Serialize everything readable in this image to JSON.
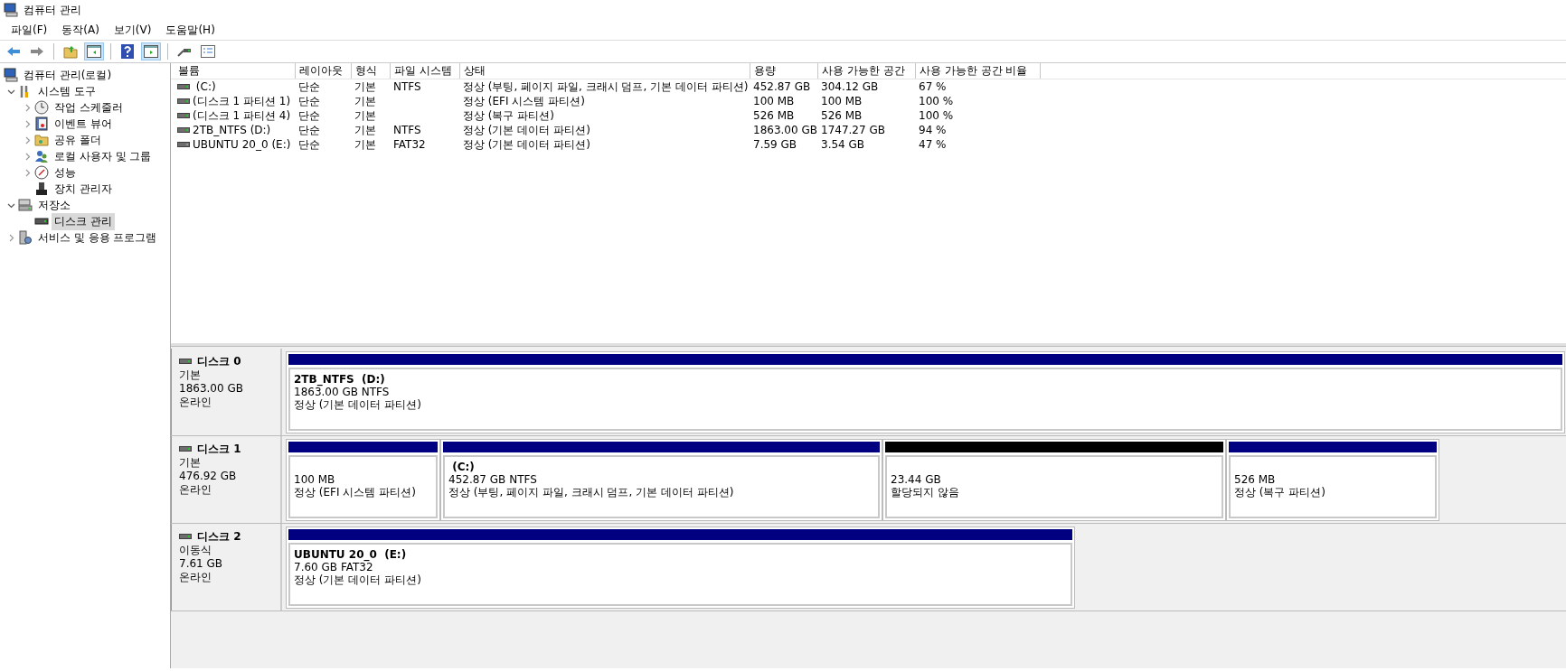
{
  "window": {
    "title": "컴퓨터 관리"
  },
  "menu": [
    "파일(F)",
    "동작(A)",
    "보기(V)",
    "도움말(H)"
  ],
  "toolbar": {
    "console_tree_pressed": true,
    "action_pane_pressed": true
  },
  "tree": [
    {
      "label": "컴퓨터 관리(로컬)",
      "selected": false,
      "children": [
        {
          "label": "시스템 도구",
          "expanded": true,
          "selected": false,
          "children": [
            {
              "label": "작업 스케줄러",
              "expanded": false,
              "selected": false
            },
            {
              "label": "이벤트 뷰어",
              "expanded": false,
              "selected": false
            },
            {
              "label": "공유 폴더",
              "expanded": false,
              "selected": false
            },
            {
              "label": "로컬 사용자 및 그룹",
              "expanded": false,
              "selected": false
            },
            {
              "label": "성능",
              "expanded": false,
              "selected": false
            },
            {
              "label": "장치 관리자",
              "selected": false
            }
          ]
        },
        {
          "label": "저장소",
          "expanded": true,
          "selected": false,
          "children": [
            {
              "label": "디스크 관리",
              "selected": true
            }
          ]
        },
        {
          "label": "서비스 및 응용 프로그램",
          "expanded": false,
          "selected": false
        }
      ]
    }
  ],
  "volumes": {
    "columns": [
      "볼륨",
      "레이아웃",
      "형식",
      "파일 시스템",
      "상태",
      "용량",
      "사용 가능한 공간",
      "사용 가능한 공간 비율"
    ],
    "rows": [
      {
        "kind": "fixed",
        "cells": [
          " (C:)",
          "단순",
          "기본",
          "NTFS",
          "정상 (부팅, 페이지 파일, 크래시 덤프, 기본 데이터 파티션)",
          "452.87 GB",
          "304.12 GB",
          "67 %"
        ]
      },
      {
        "kind": "fixed",
        "cells": [
          "(디스크 1 파티션 1)",
          "단순",
          "기본",
          "",
          "정상 (EFI 시스템 파티션)",
          "100 MB",
          "100 MB",
          "100 %"
        ]
      },
      {
        "kind": "fixed",
        "cells": [
          "(디스크 1 파티션 4)",
          "단순",
          "기본",
          "",
          "정상 (복구 파티션)",
          "526 MB",
          "526 MB",
          "100 %"
        ]
      },
      {
        "kind": "fixed",
        "cells": [
          "2TB_NTFS (D:)",
          "단순",
          "기본",
          "NTFS",
          "정상 (기본 데이터 파티션)",
          "1863.00 GB",
          "1747.27 GB",
          "94 %"
        ]
      },
      {
        "kind": "removable",
        "cells": [
          "UBUNTU 20_0 (E:)",
          "단순",
          "기본",
          "FAT32",
          "정상 (기본 데이터 파티션)",
          "7.59 GB",
          "3.54 GB",
          "47 %"
        ]
      }
    ]
  },
  "disks": [
    {
      "name": "디스크 0",
      "type": "기본",
      "size": "1863.00 GB",
      "status": "온라인",
      "partitions": [
        {
          "kind": "primary",
          "name": "2TB_NTFS  (D:)",
          "size": "1863.00 GB NTFS",
          "status": "정상 (기본 데이터 파티션)"
        }
      ]
    },
    {
      "name": "디스크 1",
      "type": "기본",
      "size": "476.92 GB",
      "status": "온라인",
      "partitions": [
        {
          "kind": "primary",
          "size": "100 MB",
          "status": "정상 (EFI 시스템 파티션)"
        },
        {
          "kind": "primary",
          "name": " (C:)",
          "size": "452.87 GB NTFS",
          "status": "정상 (부팅, 페이지 파일, 크래시 덤프, 기본 데이터 파티션)"
        },
        {
          "kind": "unallocated",
          "size": "23.44 GB",
          "status": "할당되지 않음"
        },
        {
          "kind": "primary",
          "size": "526 MB",
          "status": "정상 (복구 파티션)"
        }
      ]
    },
    {
      "name": "디스크 2",
      "type": "이동식",
      "size": "7.61 GB",
      "status": "온라인",
      "partitions": [
        {
          "kind": "primary",
          "name": "UBUNTU 20_0  (E:)",
          "size": "7.60 GB FAT32",
          "status": "정상 (기본 데이터 파티션)"
        }
      ]
    }
  ]
}
